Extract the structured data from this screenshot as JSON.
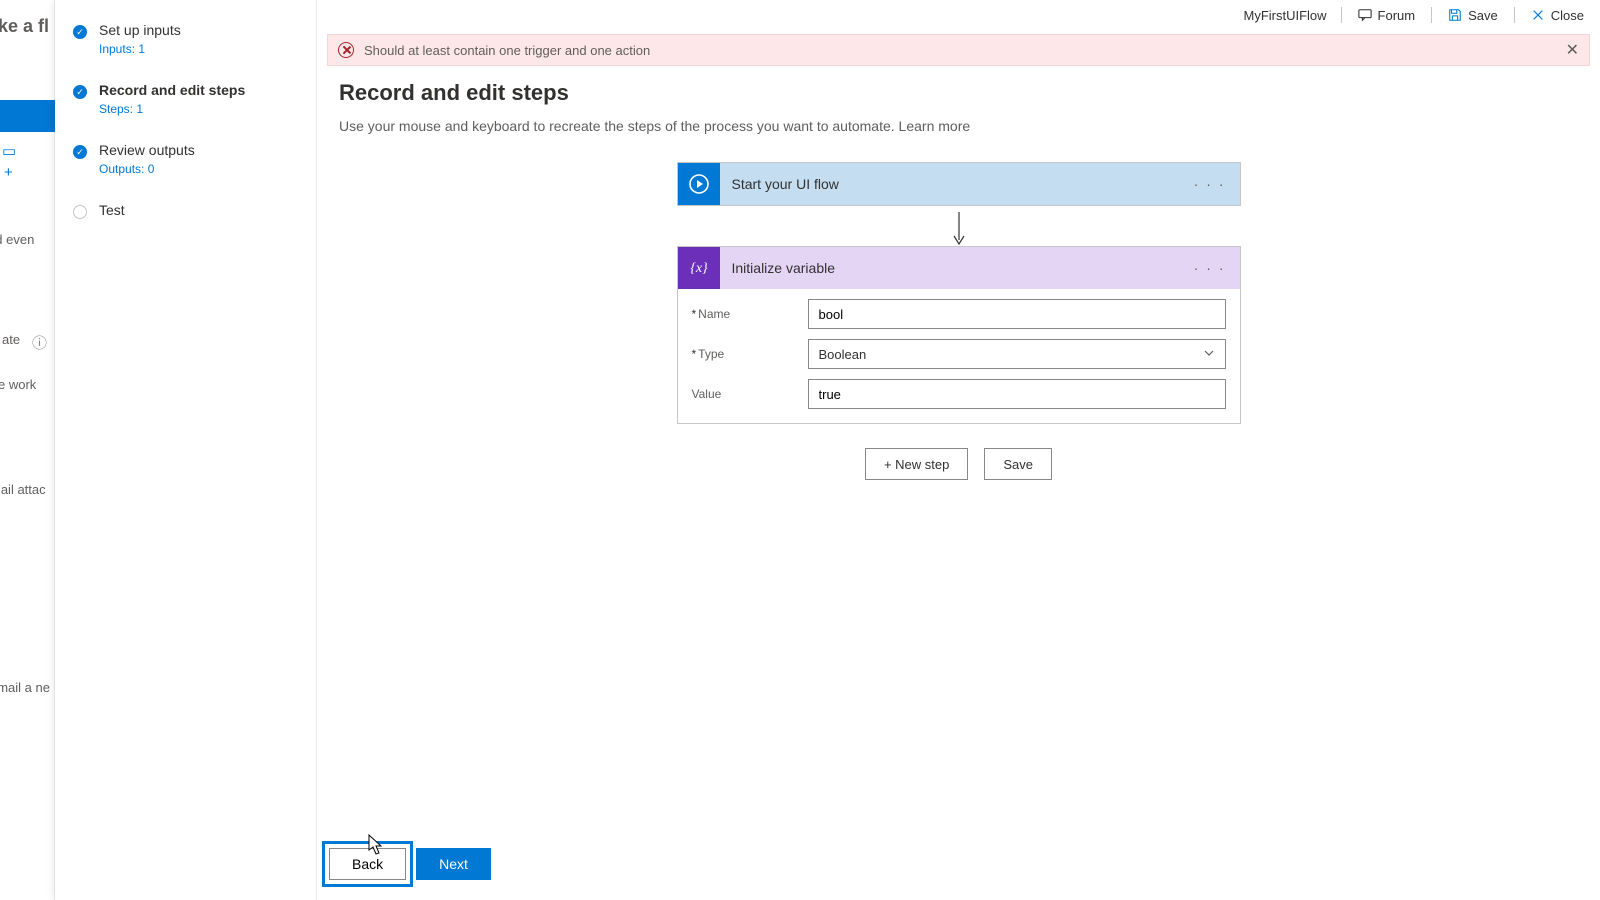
{
  "bg": {
    "title": "ake a fl",
    "item1": "nated even",
    "item2": "ate",
    "item3": "e work",
    "item4": "mail attac",
    "item5": "email a ne"
  },
  "header": {
    "flow_name": "MyFirstUIFlow",
    "forum": "Forum",
    "save": "Save",
    "close": "Close"
  },
  "wizard": {
    "s1": {
      "title": "Set up inputs",
      "sub": "Inputs: 1"
    },
    "s2": {
      "title": "Record and edit steps",
      "sub": "Steps: 1"
    },
    "s3": {
      "title": "Review outputs",
      "sub": "Outputs: 0"
    },
    "s4": {
      "title": "Test"
    }
  },
  "banner": {
    "text": "Should at least contain one trigger and one action"
  },
  "page": {
    "heading": "Record and edit steps",
    "description": "Use your mouse and keyboard to recreate the steps of the process you want to automate.  ",
    "learn_more": "Learn more"
  },
  "start_card": {
    "title": "Start your UI flow"
  },
  "var_card": {
    "title": "Initialize variable",
    "name_label": "Name",
    "type_label": "Type",
    "value_label": "Value",
    "name_value": "bool",
    "type_value": "Boolean",
    "value_value": "true"
  },
  "actions": {
    "new_step": "+ New step",
    "save": "Save"
  },
  "footer": {
    "back": "Back",
    "next": "Next"
  }
}
